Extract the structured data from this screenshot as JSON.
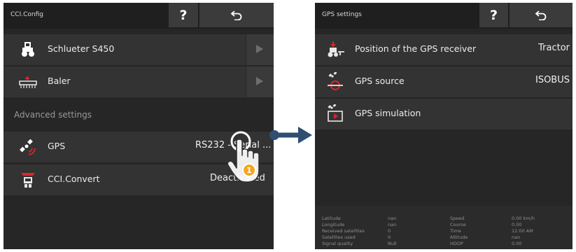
{
  "left": {
    "title": "CCI.Config",
    "help_label": "?",
    "rows": [
      {
        "label": "Schlueter S450",
        "icon": "tractor-icon"
      },
      {
        "label": "Baler",
        "icon": "baler-icon"
      }
    ],
    "section": "Advanced settings",
    "gps": {
      "label": "GPS",
      "value": "RS232 - Serial ..."
    },
    "convert": {
      "label": "CCI.Convert",
      "value": "Deactivated"
    },
    "step_number": "1"
  },
  "right": {
    "title": "GPS settings",
    "help_label": "?",
    "rows": [
      {
        "label": "Position of the GPS receiver",
        "value": "Tractor",
        "icon": "gps-receiver-position-icon"
      },
      {
        "label": "GPS source",
        "value": "ISOBUS",
        "icon": "gps-source-icon"
      },
      {
        "label": "GPS simulation",
        "value": "",
        "icon": "gps-simulation-icon"
      }
    ],
    "status": [
      {
        "label": "Latitude",
        "value": "nan"
      },
      {
        "label": "Longitude",
        "value": "nan"
      },
      {
        "label": "Received satellites",
        "value": "0"
      },
      {
        "label": "Satellites used",
        "value": "0"
      },
      {
        "label": "Signal quality",
        "value": "Null"
      },
      {
        "label": "Speed",
        "value": "0.00 km/h"
      },
      {
        "label": "Course",
        "value": "0.00"
      },
      {
        "label": "Time",
        "value": "12:00 AM"
      },
      {
        "label": "Altitude",
        "value": "nan"
      },
      {
        "label": "HDOP",
        "value": "0.00"
      }
    ]
  },
  "colors": {
    "accent": "#d9262c",
    "badge": "#f5a623",
    "connector": "#2f4e72"
  }
}
